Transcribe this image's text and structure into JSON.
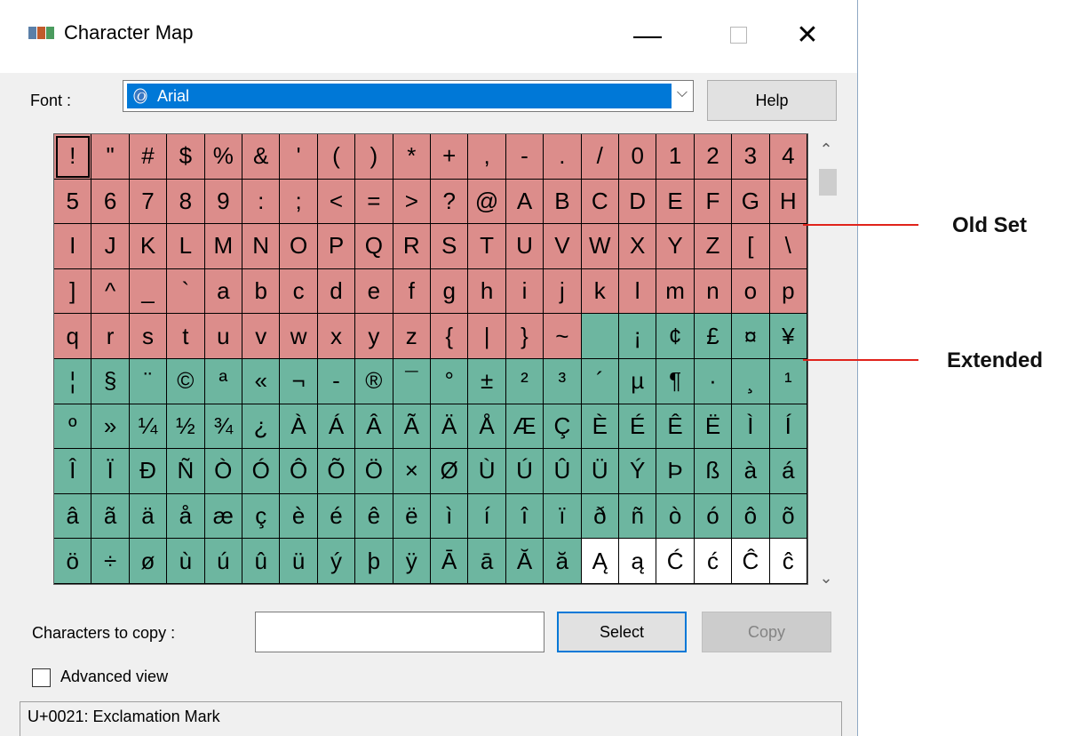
{
  "window": {
    "title": "Character Map"
  },
  "title_controls": {
    "minimize": "—",
    "close": "✕"
  },
  "font": {
    "label": "Font :",
    "value": "Arial",
    "arrow": "⌵"
  },
  "buttons": {
    "help": "Help",
    "select": "Select",
    "copy": "Copy"
  },
  "copy": {
    "label": "Characters to copy :",
    "value": ""
  },
  "advanced": {
    "label": "Advanced view",
    "checked": false
  },
  "status": {
    "text": "U+0021: Exclamation Mark"
  },
  "scrollbar": {
    "up": "⌃",
    "down": "⌄"
  },
  "grid": {
    "rows": [
      [
        "!",
        "\"",
        "#",
        "$",
        "%",
        "&",
        "'",
        "(",
        ")",
        "*",
        "+",
        ",",
        "-",
        ".",
        "/",
        "0",
        "1",
        "2",
        "3",
        "4"
      ],
      [
        "5",
        "6",
        "7",
        "8",
        "9",
        ":",
        ";",
        "<",
        "=",
        ">",
        "?",
        "@",
        "A",
        "B",
        "C",
        "D",
        "E",
        "F",
        "G",
        "H"
      ],
      [
        "I",
        "J",
        "K",
        "L",
        "M",
        "N",
        "O",
        "P",
        "Q",
        "R",
        "S",
        "T",
        "U",
        "V",
        "W",
        "X",
        "Y",
        "Z",
        "[",
        "\\"
      ],
      [
        "]",
        "^",
        "_",
        "`",
        "a",
        "b",
        "c",
        "d",
        "e",
        "f",
        "g",
        "h",
        "i",
        "j",
        "k",
        "l",
        "m",
        "n",
        "o",
        "p"
      ],
      [
        "q",
        "r",
        "s",
        "t",
        "u",
        "v",
        "w",
        "x",
        "y",
        "z",
        "{",
        "|",
        "}",
        "~",
        " ",
        "¡",
        "¢",
        "£",
        "¤",
        "¥"
      ],
      [
        "¦",
        "§",
        "¨",
        "©",
        "ª",
        "«",
        "¬",
        "-",
        "®",
        "¯",
        "°",
        "±",
        "²",
        "³",
        "´",
        "µ",
        "¶",
        "·",
        "¸",
        "¹"
      ],
      [
        "º",
        "»",
        "¼",
        "½",
        "¾",
        "¿",
        "À",
        "Á",
        "Â",
        "Ã",
        "Ä",
        "Å",
        "Æ",
        "Ç",
        "È",
        "É",
        "Ê",
        "Ë",
        "Ì",
        "Í"
      ],
      [
        "Î",
        "Ï",
        "Ð",
        "Ñ",
        "Ò",
        "Ó",
        "Ô",
        "Õ",
        "Ö",
        "×",
        "Ø",
        "Ù",
        "Ú",
        "Û",
        "Ü",
        "Ý",
        "Þ",
        "ß",
        "à",
        "á"
      ],
      [
        "â",
        "ã",
        "ä",
        "å",
        "æ",
        "ç",
        "è",
        "é",
        "ê",
        "ë",
        "ì",
        "í",
        "î",
        "ï",
        "ð",
        "ñ",
        "ò",
        "ó",
        "ô",
        "õ"
      ],
      [
        "ö",
        "÷",
        "ø",
        "ù",
        "ú",
        "û",
        "ü",
        "ý",
        "þ",
        "ÿ",
        "Ā",
        "ā",
        "Ă",
        "ă",
        "Ą",
        "ą",
        "Ć",
        "ć",
        "Ĉ",
        "ĉ"
      ]
    ],
    "old_set_count": 94,
    "extended_count": 100
  },
  "colors": {
    "old_set": "#dc8d8b",
    "extended": "#6db6a0",
    "callout": "#e0231b",
    "selection": "#0078d7"
  },
  "annotations": {
    "old_set": "Old Set",
    "extended": "Extended"
  }
}
